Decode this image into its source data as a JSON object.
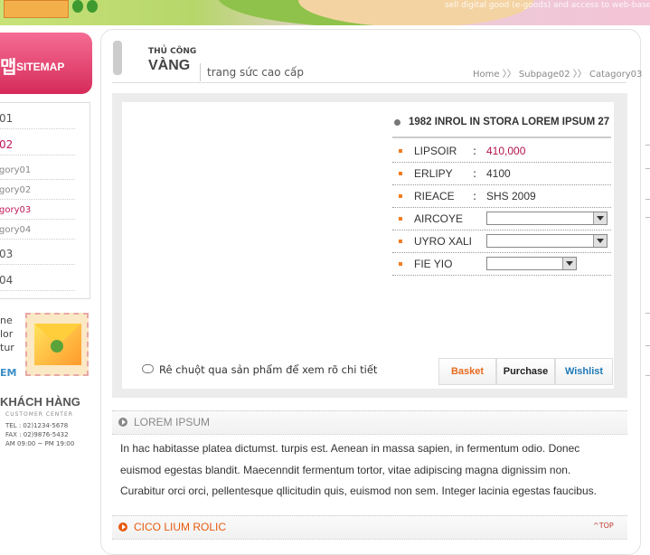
{
  "banner": {
    "tagline": "sell digital good (e-goods) and access to web-base"
  },
  "sidebar": {
    "sitemap_glyph": "맵",
    "sitemap_label": "SITEMAP",
    "menu": [
      {
        "label": "01"
      },
      {
        "label": "02"
      },
      {
        "label": "gory01"
      },
      {
        "label": "gory02"
      },
      {
        "label": "gory03"
      },
      {
        "label": "gory04"
      },
      {
        "label": "03"
      },
      {
        "label": "04"
      }
    ],
    "info_lines": [
      "ne",
      "lor",
      "tur"
    ],
    "info_more": "EM",
    "customer_title": "KHÁCH HÀNG",
    "customer_sub": "CUSTOMER CENTER",
    "tel": "TEL : 02)1234-5678",
    "fax": "FAX : 02)9876-5432",
    "hours": "AM 09:00 ~ PM 19:00"
  },
  "header": {
    "title_small": "THỦ CÔNG",
    "title_big": "VÀNG",
    "description": "trang sức cao cấp",
    "breadcrumb": "Home 〉〉 Subpage02 〉〉 Catagory03"
  },
  "product": {
    "name": "1982 INROL IN STORA LOREM IPSUM 27",
    "colon": ":",
    "fields": [
      {
        "label": "LIPSOIR",
        "value": "410,000"
      },
      {
        "label": "ERLIPY",
        "value": "4100"
      },
      {
        "label": "RIEACE",
        "value": "SHS 2009"
      }
    ],
    "options": [
      {
        "label": "AIRCOYE",
        "value": ""
      },
      {
        "label": "UYRO XALI",
        "value": ""
      },
      {
        "label": "FIE YIO",
        "value": ""
      }
    ],
    "hint": "Rê chuột qua sản phẩm để xem rõ chi tiết",
    "buttons": {
      "basket": "Basket",
      "purchase": "Purchase",
      "wishlist": "Wishlist"
    },
    "colors": {
      "basket": "#e86a1e",
      "purchase": "#222222",
      "wishlist": "#1f7ab8",
      "price": "#b0124c"
    }
  },
  "sections": [
    {
      "title": "LOREM IPSUM",
      "color": "#888888",
      "lines": [
        "In hac habitasse platea dictumst.  turpis est. Aenean in massa sapien, in fermentum odio. Donec",
        "euismod egestas blandit. Maecenndit fermentum tortor, vitae adipiscing magna dignissim non.",
        "Curabitur orci orci, pellentesque qllicitudin quis, euismod non sem. Integer lacinia egestas faucibus."
      ]
    },
    {
      "title": "CICO LIUM ROLIC",
      "color": "#e65a10"
    }
  ],
  "top_link": "TOP"
}
